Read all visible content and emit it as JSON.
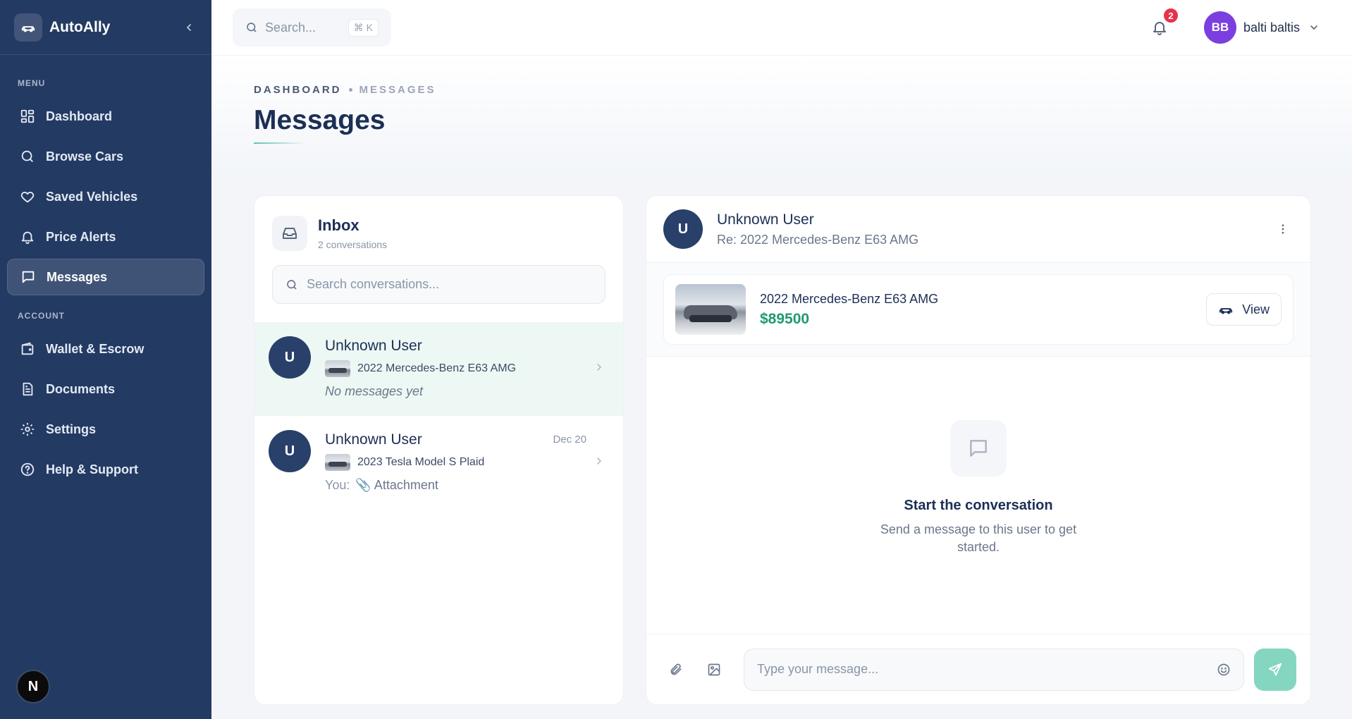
{
  "app": {
    "name": "AutoAlly"
  },
  "sidebar": {
    "menu_label": "MENU",
    "menu_items": [
      {
        "label": "Dashboard",
        "icon": "grid-icon"
      },
      {
        "label": "Browse Cars",
        "icon": "search-icon"
      },
      {
        "label": "Saved Vehicles",
        "icon": "heart-icon"
      },
      {
        "label": "Price Alerts",
        "icon": "bell-icon"
      },
      {
        "label": "Messages",
        "icon": "message-icon",
        "active": true
      }
    ],
    "account_label": "ACCOUNT",
    "account_items": [
      {
        "label": "Wallet & Escrow",
        "icon": "wallet-icon"
      },
      {
        "label": "Documents",
        "icon": "document-icon"
      },
      {
        "label": "Settings",
        "icon": "gear-icon"
      },
      {
        "label": "Help & Support",
        "icon": "help-icon"
      }
    ],
    "footer_badge": "N"
  },
  "topbar": {
    "search_placeholder": "Search...",
    "search_shortcut": "⌘ K",
    "notification_count": "2",
    "user": {
      "initials": "BB",
      "name": "balti baltis"
    }
  },
  "page": {
    "breadcrumb": [
      "DASHBOARD",
      "MESSAGES"
    ],
    "title": "Messages"
  },
  "inbox": {
    "title": "Inbox",
    "subtitle": "2 conversations",
    "search_placeholder": "Search conversations...",
    "conversations": [
      {
        "initial": "U",
        "name": "Unknown User",
        "date": "",
        "car": "2022 Mercedes-Benz E63 AMG",
        "you_prefix": "",
        "last_message": "No messages yet",
        "active": true
      },
      {
        "initial": "U",
        "name": "Unknown User",
        "date": "Dec 20",
        "car": "2023 Tesla Model S Plaid",
        "you_prefix": "You:",
        "last_message": "📎 Attachment",
        "active": false
      }
    ]
  },
  "chat": {
    "initial": "U",
    "name": "Unknown User",
    "subject": "Re: 2022 Mercedes-Benz E63 AMG",
    "vehicle": {
      "title": "2022 Mercedes-Benz E63 AMG",
      "price": "$89500",
      "view_label": "View"
    },
    "empty_title": "Start the conversation",
    "empty_text": "Send a message to this user to get started.",
    "input_placeholder": "Type your message..."
  },
  "colors": {
    "sidebar": "#233a63",
    "accent": "#1f9a73",
    "send": "#84d6c0",
    "badge": "#e5334b",
    "avatar": "#7b3fe0"
  }
}
